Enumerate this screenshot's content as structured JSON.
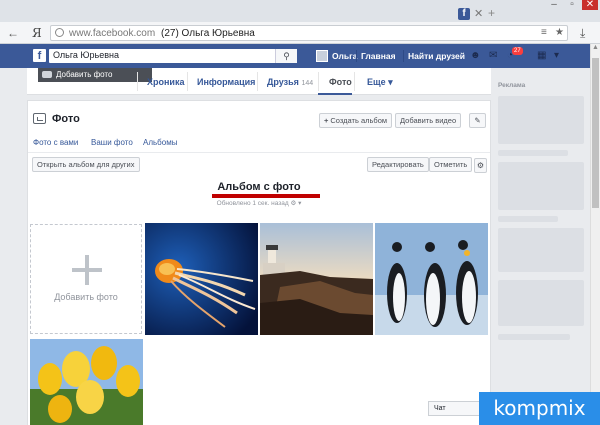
{
  "browser": {
    "tab_favicon": "f",
    "tab_close": "✕",
    "tab_new": "+",
    "yandex_button": "Я",
    "url_domain": "www.facebook.com",
    "url_page_title": "(27) Ольга Юрьевна",
    "url_menu": "≡",
    "download_arrow": "⤓"
  },
  "fb_header": {
    "logo_letter": "f",
    "search_value": "Ольга Юрьевна",
    "profile_name": "Ольга",
    "home_label": "Главная",
    "find_friends_label": "Найти друзей",
    "notification_count": "27"
  },
  "profile_nav": {
    "add_photo_label": "Добавить фото",
    "tabs": [
      {
        "label": "Хроника"
      },
      {
        "label": "Информация"
      },
      {
        "label": "Друзья",
        "count": "144"
      },
      {
        "label": "Фото"
      },
      {
        "label": "Еще ▾"
      }
    ]
  },
  "photos": {
    "title": "Фото",
    "create_album_label": "Создать альбом",
    "add_video_label": "Добавить видео",
    "subtabs": [
      "Фото с вами",
      "Ваши фото",
      "Альбомы"
    ],
    "open_for_others_label": "Открыть альбом для других",
    "edit_label": "Редактировать",
    "tag_label": "Отметить",
    "album_title": "Альбом с фото",
    "album_meta": "Обновлено 1 сек. назад",
    "add_tile_label": "Добавить фото"
  },
  "sidebar": {
    "ads_label": "Реклама"
  },
  "chat": {
    "label": "Чат (Отключен)"
  },
  "watermark": {
    "text": "kompmix"
  }
}
